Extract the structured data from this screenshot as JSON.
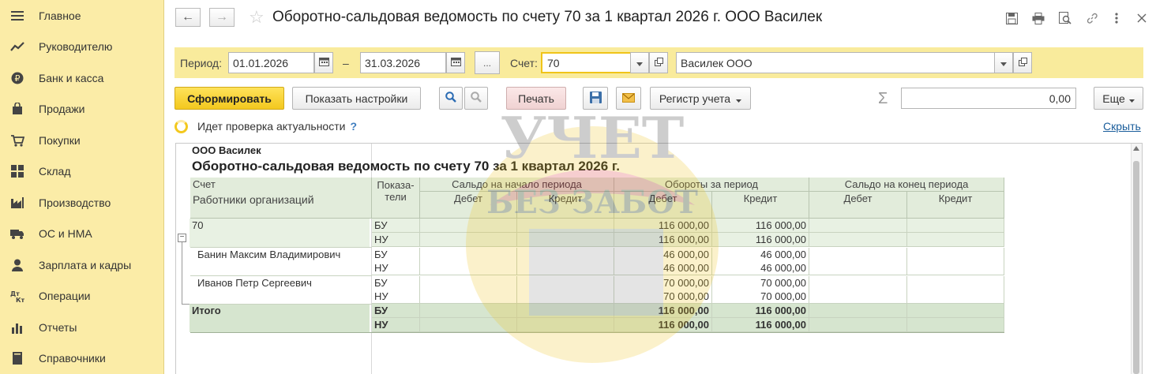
{
  "sidebar": {
    "items": [
      {
        "label": "Главное",
        "icon": "menu-icon"
      },
      {
        "label": "Руководителю",
        "icon": "trend-icon"
      },
      {
        "label": "Банк и касса",
        "icon": "ruble-icon"
      },
      {
        "label": "Продажи",
        "icon": "shopping-bag-icon"
      },
      {
        "label": "Покупки",
        "icon": "cart-icon"
      },
      {
        "label": "Склад",
        "icon": "grid-icon"
      },
      {
        "label": "Производство",
        "icon": "factory-icon"
      },
      {
        "label": "ОС и НМА",
        "icon": "truck-icon"
      },
      {
        "label": "Зарплата и кадры",
        "icon": "person-icon"
      },
      {
        "label": "Операции",
        "icon": "operations-icon"
      },
      {
        "label": "Отчеты",
        "icon": "bar-chart-icon"
      },
      {
        "label": "Справочники",
        "icon": "book-icon"
      }
    ]
  },
  "header": {
    "title": "Оборотно-сальдовая ведомость по счету 70 за 1 квартал 2026 г. ООО Василек",
    "back": "←",
    "forward": "→"
  },
  "filters": {
    "period_label": "Период:",
    "date_from": "01.01.2026",
    "dash": "–",
    "date_to": "31.03.2026",
    "dots": "...",
    "account_label": "Счет:",
    "account": "70",
    "organization": "Василек ООО"
  },
  "commands": {
    "generate": "Сформировать",
    "show_settings": "Показать настройки",
    "print": "Печать",
    "register": "Регистр учета",
    "more": "Еще",
    "sum_value": "0,00"
  },
  "status": {
    "text": "Идет проверка актуальности",
    "help": "?",
    "hide": "Скрыть"
  },
  "report": {
    "org": "ООО Василек",
    "title": "Оборотно-сальдовая ведомость по счету 70 за 1 квартал 2026 г.",
    "headers": {
      "account": "Счет",
      "subaccount": "Работники организаций",
      "indicators_1": "Показа-",
      "indicators_2": "тели",
      "opening": "Сальдо на начало периода",
      "turnover": "Обороты за период",
      "closing": "Сальдо на конец периода",
      "debit": "Дебет",
      "credit": "Кредит"
    },
    "rows": [
      {
        "name": "70",
        "ind": "БУ",
        "od": "",
        "oc": "",
        "td": "116 000,00",
        "tc": "116 000,00",
        "cd": "",
        "cc": ""
      },
      {
        "name": "",
        "ind": "НУ",
        "od": "",
        "oc": "",
        "td": "116 000,00",
        "tc": "116 000,00",
        "cd": "",
        "cc": ""
      },
      {
        "name": "Банин Максим Владимирович",
        "ind": "БУ",
        "od": "",
        "oc": "",
        "td": "46 000,00",
        "tc": "46 000,00",
        "cd": "",
        "cc": ""
      },
      {
        "name": "",
        "ind": "НУ",
        "od": "",
        "oc": "",
        "td": "46 000,00",
        "tc": "46 000,00",
        "cd": "",
        "cc": ""
      },
      {
        "name": "Иванов Петр Сергеевич",
        "ind": "БУ",
        "od": "",
        "oc": "",
        "td": "70 000,00",
        "tc": "70 000,00",
        "cd": "",
        "cc": ""
      },
      {
        "name": "",
        "ind": "НУ",
        "od": "",
        "oc": "",
        "td": "70 000,00",
        "tc": "70 000,00",
        "cd": "",
        "cc": ""
      },
      {
        "name": "Итого",
        "ind": "БУ",
        "od": "",
        "oc": "",
        "td": "116 000,00",
        "tc": "116 000,00",
        "cd": "",
        "cc": ""
      },
      {
        "name": "",
        "ind": "НУ",
        "od": "",
        "oc": "",
        "td": "116 000,00",
        "tc": "116 000,00",
        "cd": "",
        "cc": ""
      }
    ]
  },
  "watermark": {
    "line1": "УЧЕТ",
    "line2": "БЕЗ ЗАБОТ"
  },
  "colors": {
    "sidebar": "#fbeca7",
    "accent": "#f3c81e",
    "table_header": "#e2ecdb",
    "row_group": "#e8f1e3",
    "row_total": "#d6e5cf"
  }
}
